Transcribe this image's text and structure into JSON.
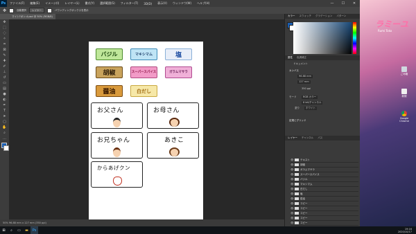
{
  "app": {
    "logo": "Ps",
    "menu": [
      "ファイル(F)",
      "編集(E)",
      "イメージ(I)",
      "レイヤー(L)",
      "書式(Y)",
      "選択範囲(S)",
      "フィルター(T)",
      "3D(D)",
      "表示(V)",
      "ウィンドウ(W)",
      "ヘルプ(H)"
    ],
    "window_controls": [
      "—",
      "☐",
      "✕"
    ]
  },
  "options": {
    "layer_select": "レイヤー",
    "auto_select": "自動選択",
    "transform": "バウンディングボックスを表示"
  },
  "document_tab": "マイシ7ボン-4.psd @ 50% (RGB/8)",
  "status": "50%     96.88 mm x 127 mm (350 ppi)",
  "canvas": {
    "spices": [
      {
        "label": "バジル",
        "bg": "#bfe79a",
        "border": "#4a8a2a",
        "color": "#1e4a10"
      },
      {
        "label": "マキシマム",
        "bg": "#bfe4f5",
        "border": "#3a8ab8",
        "color": "#1a3a66"
      },
      {
        "label": "塩",
        "bg": "#e8eef8",
        "border": "#8ab0d8",
        "color": "#1a4aa0"
      },
      {
        "label": "胡椒",
        "bg": "#c9a35c",
        "border": "#6a4a18",
        "color": "#2a1a08"
      },
      {
        "label": "スーパースパイス",
        "bg": "#f29bc7",
        "border": "#b04a80",
        "color": "#8a1040"
      },
      {
        "label": "ガラムマサラ",
        "bg": "#f0b0d8",
        "border": "#b04a90",
        "color": "#6a2058"
      },
      {
        "label": "醤油",
        "bg": "#d99a3c",
        "border": "#7a4a10",
        "color": "#3a1a00"
      },
      {
        "label": "白だし",
        "bg": "#f6e8a8",
        "border": "#c8a840",
        "color": "#a06a10"
      }
    ],
    "family": [
      {
        "name": "お父さん",
        "hair": "#222222"
      },
      {
        "name": "お母さん",
        "hair": "#5a2a10"
      },
      {
        "name": "お兄ちゃん",
        "hair": "#6a3010"
      },
      {
        "name": "あきこ",
        "hair": "#6a3a18"
      },
      {
        "name": "からあげクン",
        "hair": "#c03020"
      }
    ]
  },
  "panels": {
    "color_tabs": [
      "カラー",
      "スウォッチ",
      "グラデーション",
      "パターン"
    ],
    "prop_tabs": [
      "属性",
      "色調補正"
    ],
    "properties_title": "ドキュメント",
    "canvas_label": "カンバス",
    "width": "96.88 mm",
    "height": "127 mm",
    "resolution": "350 ppi",
    "mode_label": "モード",
    "mode_value": "RGB カラー",
    "bits": "8 bit/チャンネル",
    "fill_label": "塗り",
    "fill_value": "ホワイト",
    "guides_label": "定規とグリッド",
    "layer_tabs": [
      "レイヤー",
      "チャンネル",
      "パス"
    ],
    "layers": [
      "テキスト",
      "胡椒",
      "ガラムマサラ",
      "スーパースパイス",
      "バジル",
      "マキシマム",
      "白だし",
      "塩",
      "醤油",
      "コピー",
      "コピー",
      "コピー",
      "コピー",
      "コピー",
      "背景"
    ]
  },
  "desktop": {
    "logo": "ラミーユ",
    "subtitle": "Rumi Toko",
    "icons": [
      "ごみ箱",
      "新規",
      "Google Chrome"
    ]
  },
  "taskbar": {
    "time": "19:16",
    "date": "2020/10/17"
  }
}
